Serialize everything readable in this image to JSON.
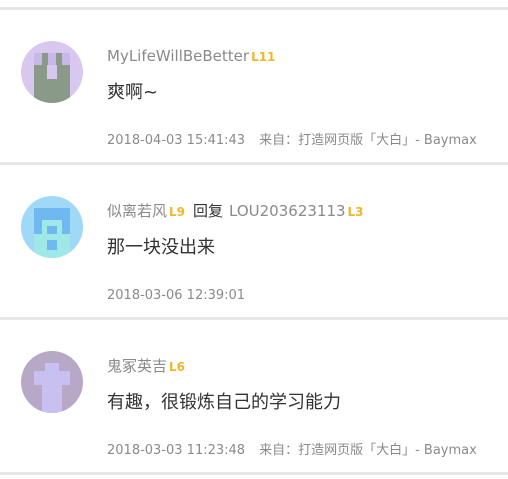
{
  "comments": [
    {
      "username": "MyLifeWillBeBetter",
      "level": "L11",
      "text": "爽啊~",
      "time": "2018-04-03 15:41:43",
      "source": "来自：打造网页版「大白」- Baymax"
    },
    {
      "username": "似离若风",
      "level": "L9",
      "reply_word": "回复",
      "reply_to": "LOU203623113",
      "reply_level": "L3",
      "text": "那一块没出来",
      "time": "2018-03-06 12:39:01"
    },
    {
      "username": "鬼冢英吉",
      "level": "L6",
      "text": "有趣，很锻炼自己的学习能力",
      "time": "2018-03-03 11:23:48",
      "source": "来自：打造网页版「大白」- Baymax"
    }
  ],
  "colors": {
    "level_badge": "#f0b62c",
    "username": "#8a8a8a",
    "body_text": "#333333",
    "divider": "#e6e6e6"
  }
}
